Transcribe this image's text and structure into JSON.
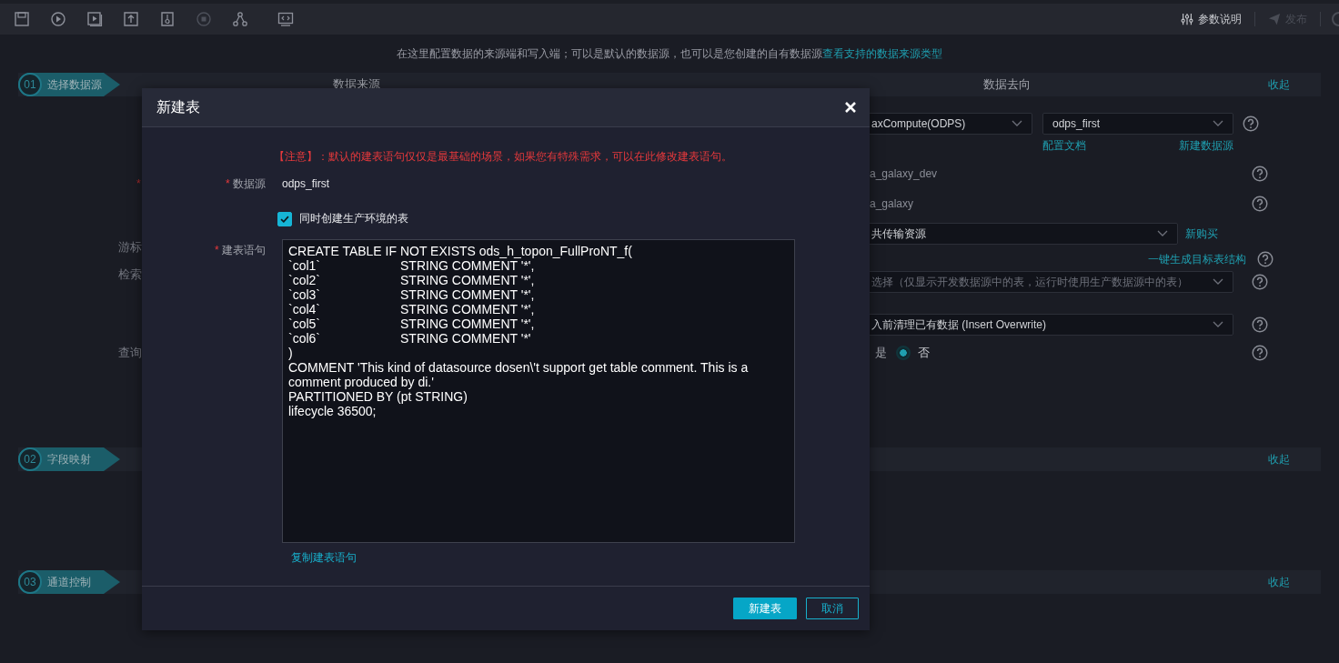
{
  "toolbar": {
    "params_label": "参数说明",
    "publish": {
      "label": "发布",
      "disabled": true
    }
  },
  "intro": {
    "text": "在这里配置数据的来源端和写入端；可以是默认的数据源，也可以是您创建的自有数据源",
    "link": "查看支持的数据来源类型"
  },
  "sections": [
    {
      "number": "01",
      "title": "选择数据源",
      "source_heading": "数据来源",
      "target_heading": "数据去向",
      "collapse": "收起"
    },
    {
      "number": "02",
      "title": "字段映射",
      "collapse": "收起"
    },
    {
      "number": "03",
      "title": "通道控制",
      "collapse": "收起"
    }
  ],
  "source_form": {
    "required_mark": "*",
    "labels": [
      "游标",
      "检索",
      "查询"
    ]
  },
  "target_form": [
    {
      "kind": "select_pair",
      "values": [
        "axCompute(ODPS)",
        "odps_first"
      ],
      "links": [
        "配置文档",
        "新建数据源"
      ],
      "help": true
    },
    {
      "kind": "text",
      "value": "a_galaxy_dev",
      "help": true
    },
    {
      "kind": "text",
      "value": "a_galaxy",
      "help": true
    },
    {
      "kind": "select_link",
      "value": "共传输资源",
      "link": "新购买",
      "help": false
    },
    {
      "kind": "link",
      "link": "一键生成目标表结构",
      "help": true
    },
    {
      "kind": "select",
      "placeholder": "选择（仅显示开发数据源中的表，运行时使用生产数据源中的表）",
      "help": true
    },
    {
      "kind": "select",
      "value": "入前清理已有数据 (Insert Overwrite)",
      "help": true
    },
    {
      "kind": "radio",
      "options": [
        {
          "label": "是",
          "selected": false
        },
        {
          "label": "否",
          "selected": true
        }
      ],
      "help": true
    }
  ],
  "modal": {
    "title": "新建表",
    "notice": "【注意】：默认的建表语句仅仅是最基础的场景，如果您有特殊需求，可以在此修改建表语句。",
    "datasource": {
      "label": "数据源",
      "required": true,
      "value": "odps_first"
    },
    "checkbox": {
      "label": "同时创建生产环境的表",
      "checked": true
    },
    "ddl": {
      "label": "建表语句",
      "required": true,
      "value": "CREATE TABLE IF NOT EXISTS ods_h_topon_FullProNT_f(\n`col1`\tSTRING COMMENT '*',\n`col2`\tSTRING COMMENT '*',\n`col3`\tSTRING COMMENT '*',\n`col4`\tSTRING COMMENT '*',\n`col5`\tSTRING COMMENT '*',\n`col6`\tSTRING COMMENT '*'\n)\nCOMMENT 'This kind of datasource dosen\\'t support get table comment. This is a comment produced by di.'\nPARTITIONED BY (pt STRING)\nlifecycle 36500;"
    },
    "copy_link": "复制建表语句",
    "buttons": [
      {
        "label": "新建表",
        "kind": "primary"
      },
      {
        "label": "取消",
        "kind": "secondary"
      }
    ]
  }
}
